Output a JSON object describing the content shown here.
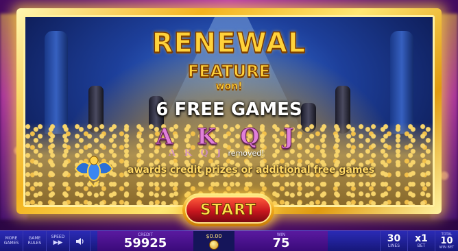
{
  "popup": {
    "title_line1": "RENEWAL",
    "title_line2": "FEATURE",
    "title_line3": "won!",
    "free_games": "6 FREE GAMES",
    "removed_symbols": "A K Q J",
    "removed_symbols_small": "A K Q J",
    "removed_text": "removed!",
    "awards_text": "awards credit prizes or additional free games",
    "start_label": "START",
    "emblem_icon": "scarab-icon"
  },
  "bottom_bar": {
    "more_games": "MORE GAMES",
    "game_rules": "GAME RULES",
    "speed_label": "SPEED",
    "speed_icon": "fast-forward-icon",
    "sound_icon": "speaker-icon",
    "credit_label": "CREDIT",
    "credit_value": "59925",
    "coin_label": "$0.00",
    "win_label": "WIN",
    "win_value": "75",
    "lines_value": "30",
    "lines_label": "LINES",
    "bet_value": "x1",
    "bet_label": "BET",
    "total_bet_top": "TOTAL",
    "total_bet_value": "10",
    "total_bet_label": "WIN BET"
  },
  "colors": {
    "title_gold": "#ffd23a",
    "frame_gold": "#f3b31e",
    "start_red": "#c8161e",
    "bar_blue": "#2b2bb5",
    "panel_purple": "#5a1aa0"
  }
}
